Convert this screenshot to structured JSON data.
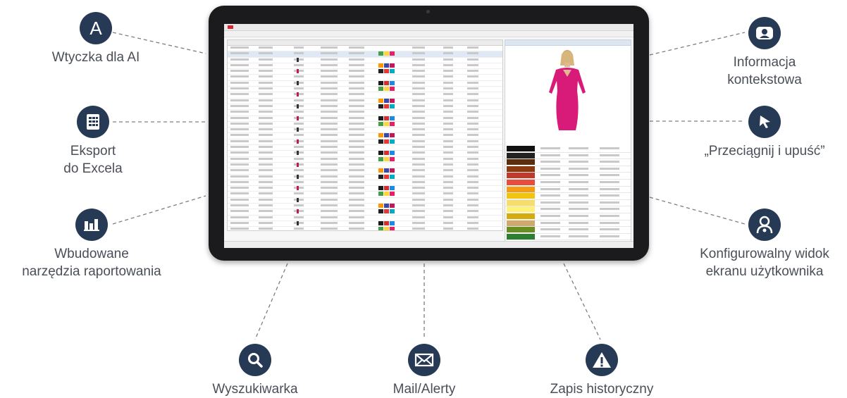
{
  "features": {
    "ai_plugin": {
      "label": "Wtyczka dla AI",
      "glyph": "A"
    },
    "excel_export": {
      "line1": "Eksport",
      "line2": "do Excela"
    },
    "reporting": {
      "line1": "Wbudowane",
      "line2": "narzędzia raportowania"
    },
    "context_info": {
      "line1": "Informacja",
      "line2": "kontekstowa"
    },
    "drag_drop": {
      "label": "„Przeciągnij i upuść”"
    },
    "configurable_view": {
      "line1": "Konfigurowalny widok",
      "line2": "ekranu użytkownika"
    },
    "search": {
      "label": "Wyszukiwarka"
    },
    "mail_alerts": {
      "label": "Mail/Alerty"
    },
    "history": {
      "label": "Zapis historyczny"
    }
  },
  "colors": {
    "icon_bg": "#263a56",
    "line": "#7a7f87",
    "bezel": "#1b1b1d",
    "text": "#4a4f57"
  },
  "icons": [
    "letter-a-icon",
    "spreadsheet-icon",
    "bar-chart-icon",
    "contact-card-icon",
    "cursor-arrow-icon",
    "user-settings-icon",
    "magnifier-icon",
    "envelope-icon",
    "warning-icon"
  ]
}
